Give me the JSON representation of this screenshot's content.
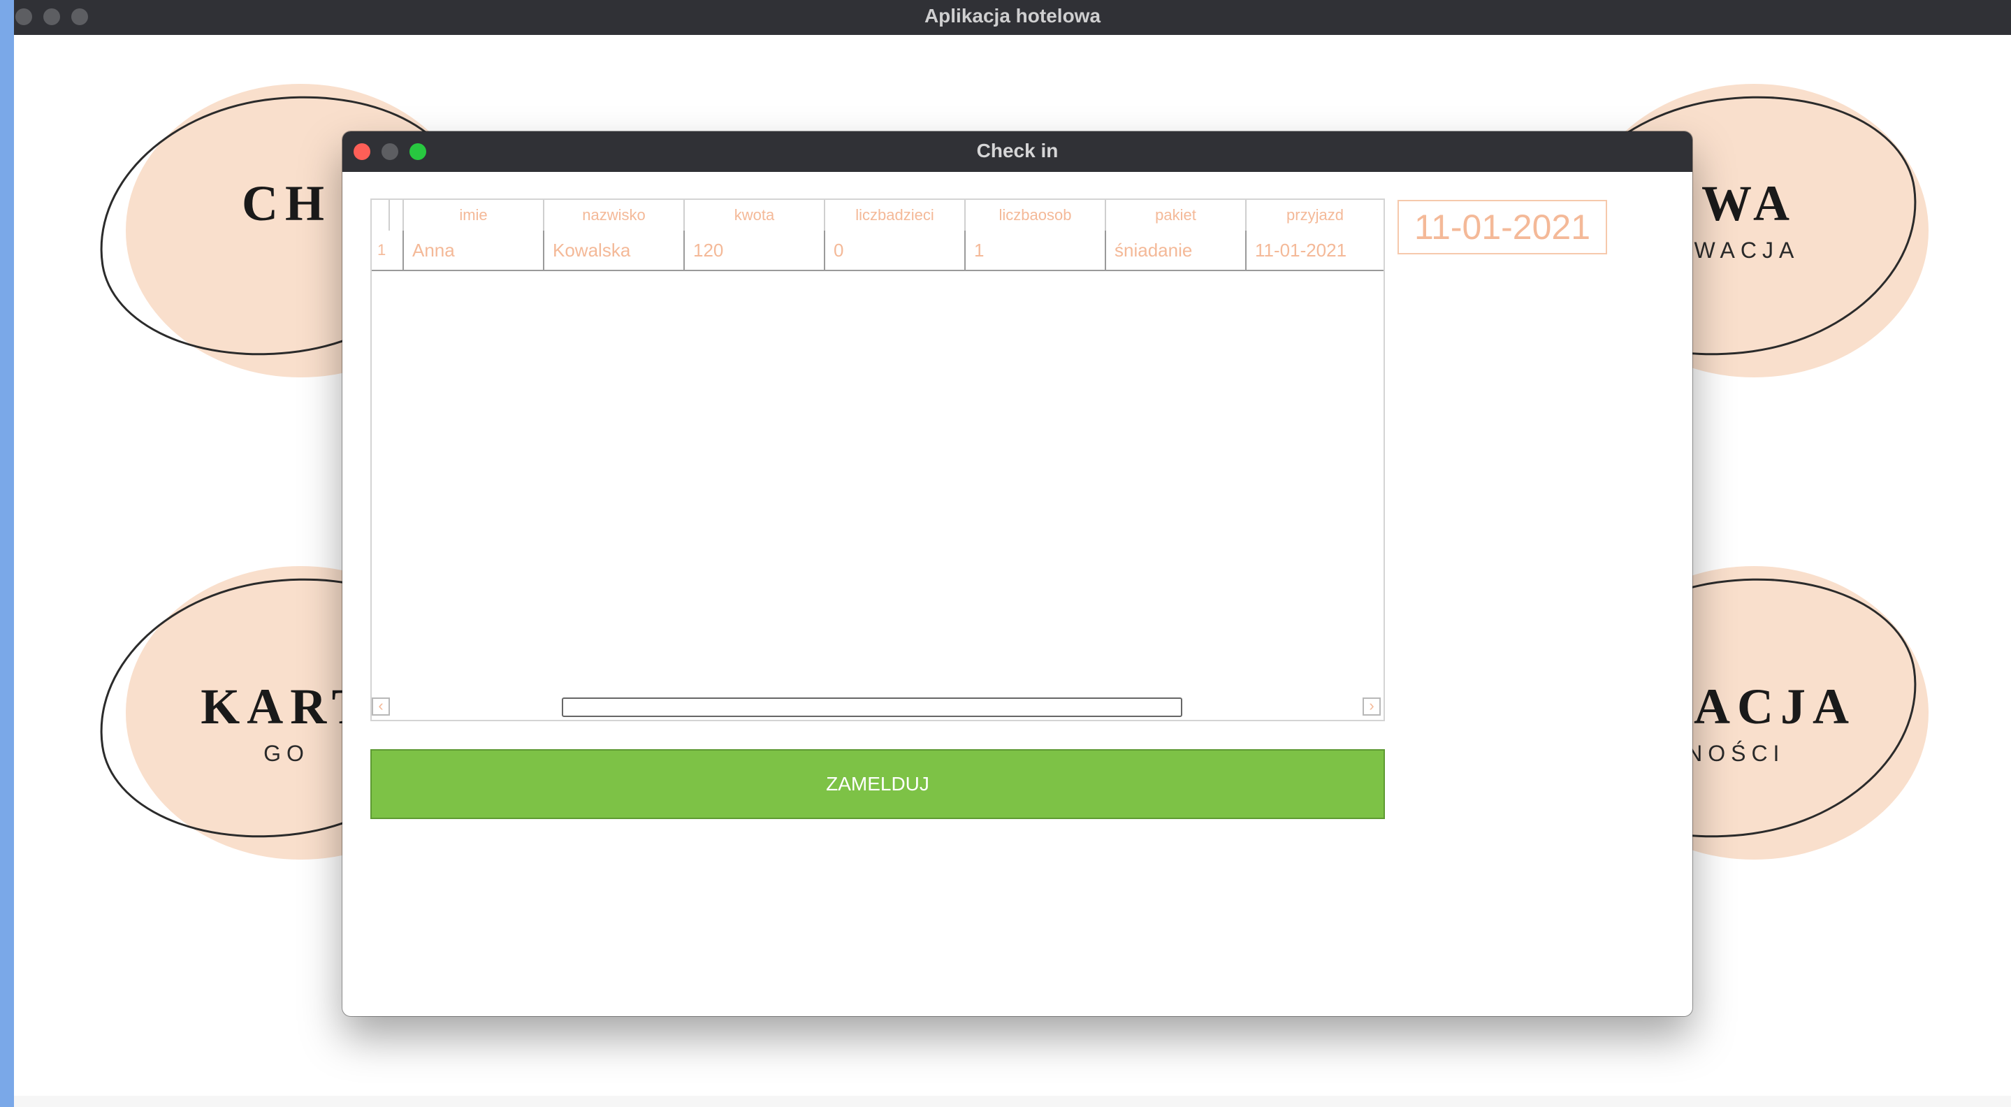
{
  "main_window": {
    "title": "Aplikacja hotelowa"
  },
  "tiles": [
    {
      "title": "CH",
      "subtitle": ""
    },
    {
      "title": "OWA",
      "subtitle": "ERWACJA"
    },
    {
      "title": "KART",
      "subtitle": "GO"
    },
    {
      "title": "ULACJA",
      "subtitle": "TNOŚCI"
    }
  ],
  "dialog": {
    "title": "Check in",
    "table": {
      "columns": [
        "imie",
        "nazwisko",
        "kwota",
        "liczbadzieci",
        "liczbaosob",
        "pakiet",
        "przyjazd"
      ],
      "rows": [
        {
          "index": "1",
          "imie": "Anna",
          "nazwisko": "Kowalska",
          "kwota": "120",
          "liczbadzieci": "0",
          "liczbaosob": "1",
          "pakiet": "śniadanie",
          "przyjazd": "11-01-2021"
        }
      ],
      "scroll_left_icon": "‹",
      "scroll_right_icon": "›"
    },
    "date": "11-01-2021",
    "checkin_label": "ZAMELDUJ"
  },
  "colors": {
    "accent_text": "#f4b998",
    "button_green": "#7dc246",
    "tile_blob": "#f9dfcc"
  }
}
